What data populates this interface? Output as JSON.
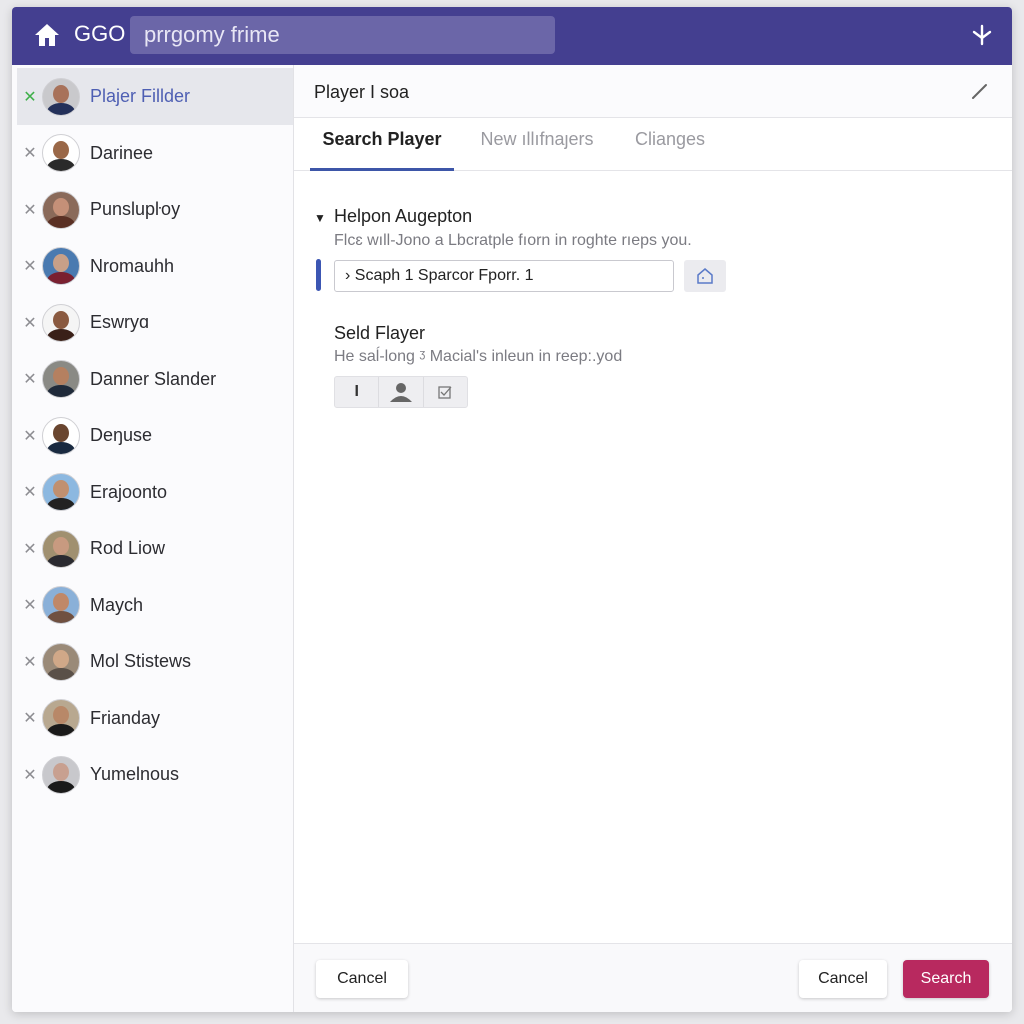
{
  "topbar": {
    "brand": "GGO",
    "search_value": "prrgomy frime",
    "home_icon": "home-icon",
    "action_icon": "fork-icon"
  },
  "sidebar": {
    "players": [
      {
        "name": "Plajer Fillder",
        "selected": true,
        "skin": "#a8725a",
        "shirt": "#23305a",
        "bg": "#c9c9cc"
      },
      {
        "name": "Darinee",
        "selected": false,
        "skin": "#9a6848",
        "shirt": "#2a2a2a",
        "bg": "#ffffff"
      },
      {
        "name": "Punslupŀoy",
        "selected": false,
        "skin": "#c59078",
        "shirt": "#5a3024",
        "bg": "#8a6a5a"
      },
      {
        "name": "Nromauhh",
        "selected": false,
        "skin": "#c8a088",
        "shirt": "#7a2030",
        "bg": "#4a7ab0"
      },
      {
        "name": "Eswryɑ",
        "selected": false,
        "skin": "#8a5a40",
        "shirt": "#3a2018",
        "bg": "#f5f5f5"
      },
      {
        "name": "Danner Slander",
        "selected": false,
        "skin": "#b58060",
        "shirt": "#1f2a3a",
        "bg": "#8a8a85"
      },
      {
        "name": "Deŋuse",
        "selected": false,
        "skin": "#6a4630",
        "shirt": "#1a2a40",
        "bg": "#ffffff"
      },
      {
        "name": "Erajoonto",
        "selected": false,
        "skin": "#c09070",
        "shirt": "#222222",
        "bg": "#8cb8e0"
      },
      {
        "name": "Rod Liow",
        "selected": false,
        "skin": "#c89a80",
        "shirt": "#2a2a30",
        "bg": "#a09070"
      },
      {
        "name": "Maych",
        "selected": false,
        "skin": "#c08868",
        "shirt": "#705040",
        "bg": "#8ab0d8"
      },
      {
        "name": "Mol Stistews",
        "selected": false,
        "skin": "#d0a888",
        "shirt": "#5a5048",
        "bg": "#9a8a78"
      },
      {
        "name": "Frianday",
        "selected": false,
        "skin": "#b88868",
        "shirt": "#1a1a1a",
        "bg": "#b8a890"
      },
      {
        "name": "Yumelnous",
        "selected": false,
        "skin": "#c8a090",
        "shirt": "#1a1a1a",
        "bg": "#c8c8cc"
      }
    ]
  },
  "panel": {
    "title": "Player I soa",
    "tabs": [
      "Search Player",
      "New ıllıfnaȷers",
      "Clianges"
    ],
    "active_tab": 0,
    "section1": {
      "title": "Helpon Augepton",
      "desc": "Flcɛ wıll-Jono a Lbcratple fıorn in roghte rıeps you.",
      "input_value": "› Scaph 1 Sparcor Fporr. 1"
    },
    "section2": {
      "title": "Seld Flayer",
      "desc": "He saĺ-long ᶾ Macialʹs inleun in reep:.yod",
      "segments": [
        "I",
        "person-icon",
        "checkbox-icon"
      ]
    }
  },
  "footer": {
    "left_cancel": "Cancel",
    "right_cancel": "Cancel",
    "search": "Search"
  },
  "colors": {
    "topbar": "#443f90",
    "accent": "#3d56a8",
    "primary_button": "#b8295f",
    "selected_x": "#3fb04a"
  }
}
